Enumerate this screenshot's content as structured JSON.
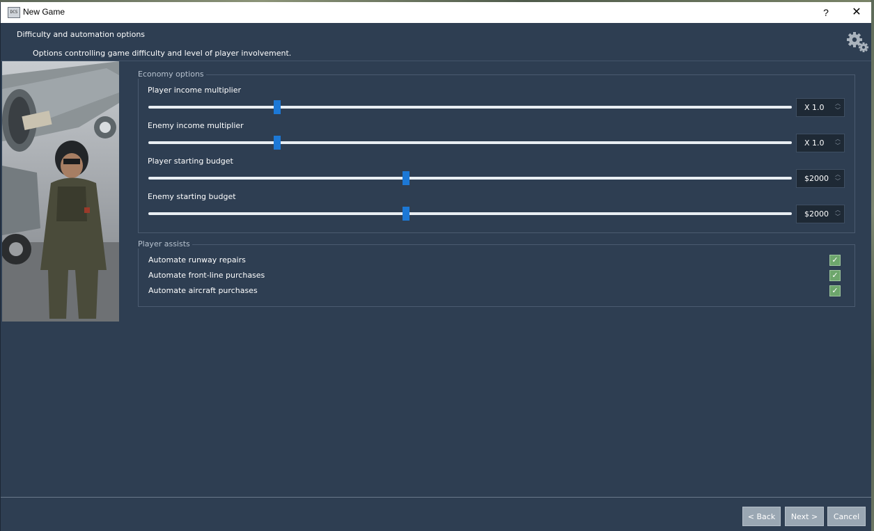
{
  "window": {
    "title": "New Game",
    "icon_label": "DCS",
    "help_label": "?",
    "close_label": "✕"
  },
  "header": {
    "title": "Difficulty and automation options",
    "subtitle": "Options controlling game difficulty and level of player involvement."
  },
  "economy": {
    "group_title": "Economy options",
    "sliders": [
      {
        "label": "Player income multiplier",
        "value_text": "X 1.0",
        "level": 0.2
      },
      {
        "label": "Enemy income multiplier",
        "value_text": "X 1.0",
        "level": 0.2
      },
      {
        "label": "Player starting budget",
        "value_text": "$2000",
        "level": 0.4
      },
      {
        "label": "Enemy starting budget",
        "value_text": "$2000",
        "level": 0.4
      }
    ]
  },
  "assists": {
    "group_title": "Player assists",
    "items": [
      {
        "label": "Automate runway repairs",
        "checked": true
      },
      {
        "label": "Automate front-line purchases",
        "checked": true
      },
      {
        "label": "Automate aircraft purchases",
        "checked": true
      }
    ]
  },
  "footer": {
    "back_label": "< Back",
    "next_label": "Next >",
    "cancel_label": "Cancel"
  },
  "colors": {
    "background": "#2e3e52",
    "slider_handle": "#1c78d6",
    "checkbox_checked": "#6da66c",
    "button_disabled": "#9aa7b3"
  },
  "icons": {
    "settings": "gears-icon",
    "check": "check-icon"
  }
}
